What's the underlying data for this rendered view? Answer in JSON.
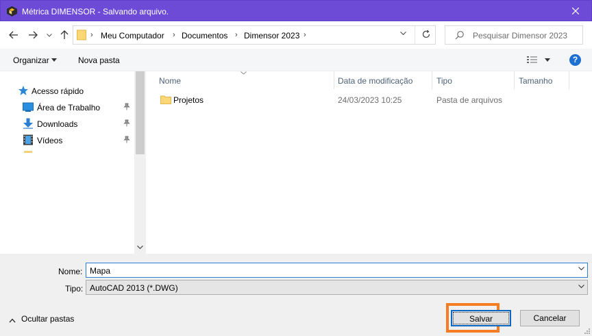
{
  "window": {
    "title": "Métrica DIMENSOR - Salvando arquivo.",
    "accent": "#6e4bd6"
  },
  "address": {
    "crumbs": [
      "Meu Computador",
      "Documentos",
      "Dimensor 2023"
    ]
  },
  "search": {
    "placeholder": "Pesquisar Dimensor 2023"
  },
  "toolbar": {
    "organize": "Organizar",
    "new_folder": "Nova pasta"
  },
  "nav": [
    {
      "label": "Acesso rápido",
      "icon": "star-icon"
    },
    {
      "label": "Área de Trabalho",
      "icon": "desktop-icon"
    },
    {
      "label": "Downloads",
      "icon": "download-icon"
    },
    {
      "label": "Vídeos",
      "icon": "videos-icon"
    }
  ],
  "columns": {
    "name": "Nome",
    "date": "Data de modificação",
    "type": "Tipo",
    "size": "Tamanho"
  },
  "files": [
    {
      "name": "Projetos",
      "date": "24/03/2023 10:25",
      "type": "Pasta de arquivos",
      "size": ""
    }
  ],
  "form": {
    "name_label": "Nome:",
    "name_value": "Mapa",
    "type_label": "Tipo:",
    "type_value": "AutoCAD 2013 (*.DWG)"
  },
  "footer": {
    "hide_folders": "Ocultar pastas",
    "save": "Salvar",
    "cancel": "Cancelar",
    "highlight_color": "#f57c20"
  }
}
